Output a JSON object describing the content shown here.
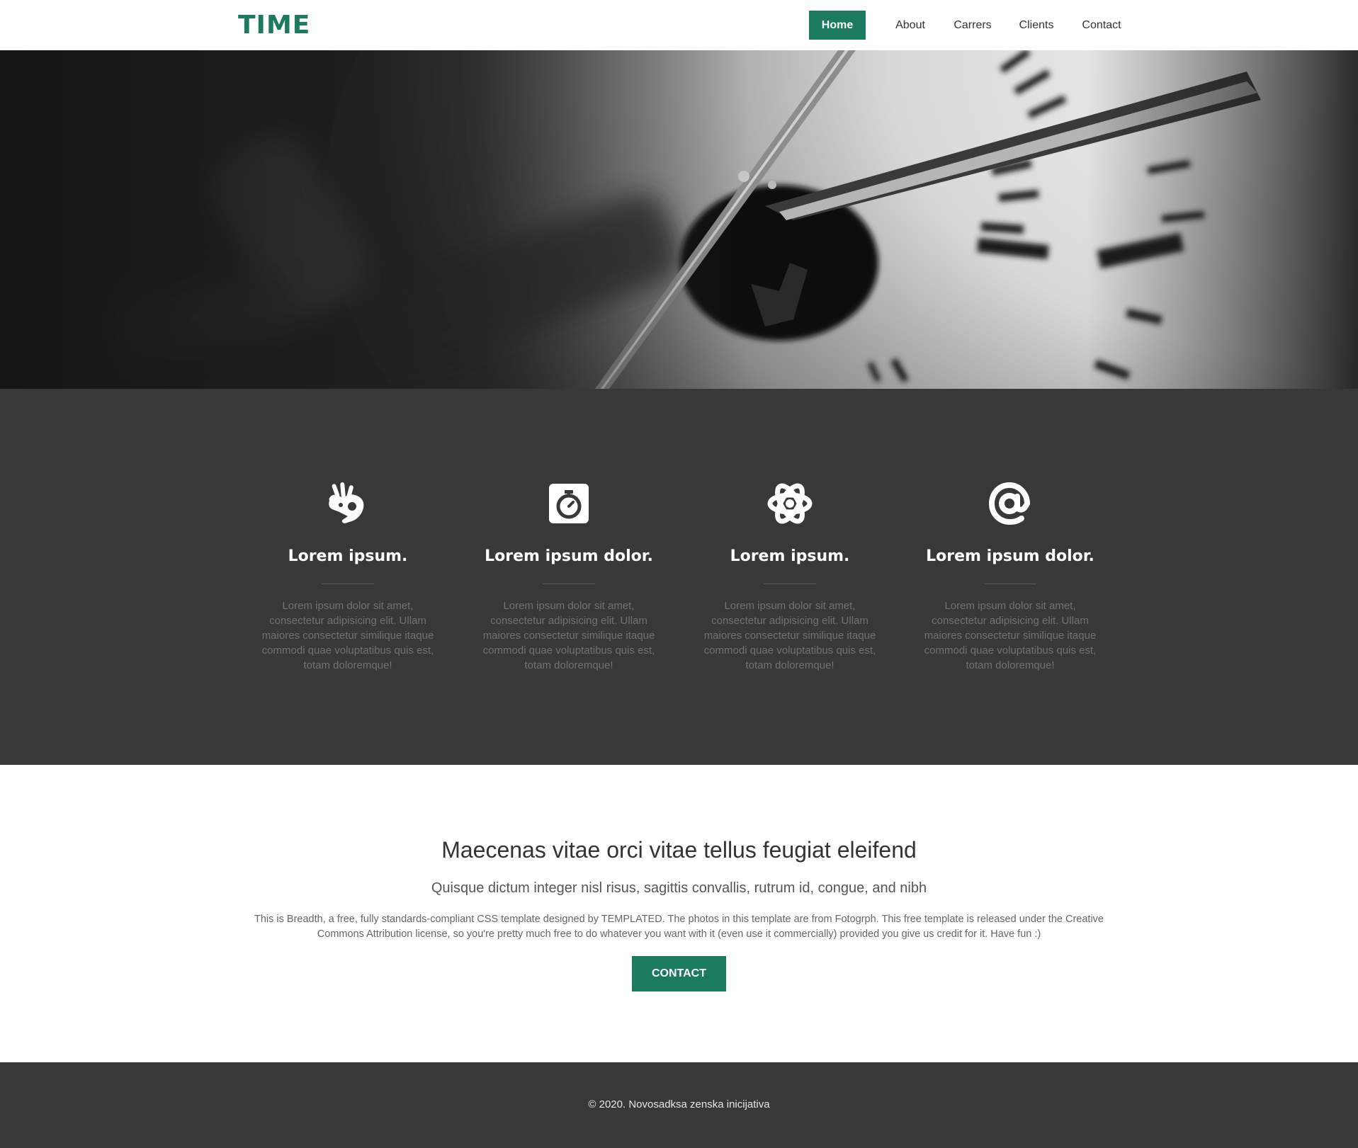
{
  "header": {
    "logo": "TIME",
    "nav": [
      {
        "label": "Home",
        "active": true
      },
      {
        "label": "About",
        "active": false
      },
      {
        "label": "Carrers",
        "active": false
      },
      {
        "label": "Clients",
        "active": false
      },
      {
        "label": "Contact",
        "active": false
      }
    ]
  },
  "hero": {
    "image": "black-and-white clock face close-up"
  },
  "features": [
    {
      "icon": "sign-language-icon",
      "title": "Lorem ipsum.",
      "text": "Lorem ipsum dolor sit amet, consectetur adipisicing elit. Ullam maiores consectetur similique itaque commodi quae voluptatibus quis est, totam doloremque!"
    },
    {
      "icon": "stopwatch-icon",
      "title": "Lorem ipsum dolor.",
      "text": "Lorem ipsum dolor sit amet, consectetur adipisicing elit. Ullam maiores consectetur similique itaque commodi quae voluptatibus quis est, totam doloremque!"
    },
    {
      "icon": "atom-icon",
      "title": "Lorem ipsum.",
      "text": "Lorem ipsum dolor sit amet, consectetur adipisicing elit. Ullam maiores consectetur similique itaque commodi quae voluptatibus quis est, totam doloremque!"
    },
    {
      "icon": "at-sign-icon",
      "title": "Lorem ipsum dolor.",
      "text": "Lorem ipsum dolor sit amet, consectetur adipisicing elit. Ullam maiores consectetur similique itaque commodi quae voluptatibus quis est, totam doloremque!"
    }
  ],
  "content": {
    "title": "Maecenas vitae orci vitae tellus feugiat eleifend",
    "subtitle": "Quisque dictum integer nisl risus, sagittis convallis, rutrum id, congue, and nibh",
    "body": "This is Breadth, a free, fully standards-compliant CSS template designed by TEMPLATED. The photos in this template are from Fotogrph. This free template is released under the Creative Commons Attribution license, so you're pretty much free to do whatever you want with it (even use it commercially) provided you give us credit for it. Have fun :)",
    "button_label": "CONTACT"
  },
  "footer": {
    "text": "© 2020. Novosadksa zenska inicijativa"
  },
  "colors": {
    "accent": "#1b7a5f",
    "dark_section": "#383838",
    "text_dark": "#333333"
  }
}
